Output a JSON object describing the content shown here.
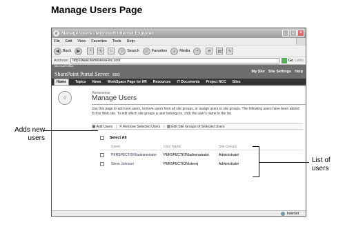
{
  "figure_title": "Manage Users Page",
  "window": {
    "title": "Manage Users - Microsoft Internet Explorer",
    "ie_icon": "e",
    "controls": [
      "_",
      "□",
      "×"
    ]
  },
  "menubar": [
    "File",
    "Edit",
    "View",
    "Favorites",
    "Tools",
    "Help"
  ],
  "toolbar": {
    "back_label": "Back",
    "search_label": "Search",
    "favorites_label": "Favorites",
    "media_label": "Media"
  },
  "addressbar": {
    "label": "Address",
    "url": "http://www.homesense-inc.com",
    "go_label": "Go",
    "links_label": "Links"
  },
  "sharepoint": {
    "logo_small": "Microsoft Office",
    "logo_big": "SharePoint Portal Server",
    "logo_year": "2003",
    "header_links": [
      "My Site",
      "Site Settings",
      "Help"
    ],
    "nav_tabs": [
      "Home",
      "Topics",
      "News",
      "WorkSpace Page for HR",
      "Resources",
      "IT Documents",
      "Project NCC",
      "Sites"
    ]
  },
  "page": {
    "site_name": "Homesense",
    "heading": "Manage Users",
    "description": "Use this page to add new users, remove users from all site groups, or assign users to site groups. The following users have been added to this Web site. To edit which site groups a user belongs to, click the user's name in the list.",
    "actions": {
      "add": "Add Users",
      "remove": "Remove Selected Users",
      "edit": "Edit Site Groups of Selected Users"
    },
    "select_all": "Select All",
    "columns": [
      "Users",
      "User Name",
      "Site Groups"
    ],
    "rows": [
      {
        "user": "PERSPECTION\\administrator",
        "username": "PERSPECTION\\administrator",
        "groups": "Administrator"
      },
      {
        "user": "Steve Johnson",
        "username": "PERSPECTION\\stevej",
        "groups": "Administrator"
      }
    ]
  },
  "statusbar": {
    "zone": "Internet"
  },
  "callouts": {
    "adds_new_users": [
      "Adds new",
      "users"
    ],
    "list_of_users": [
      "List of",
      "users"
    ]
  }
}
